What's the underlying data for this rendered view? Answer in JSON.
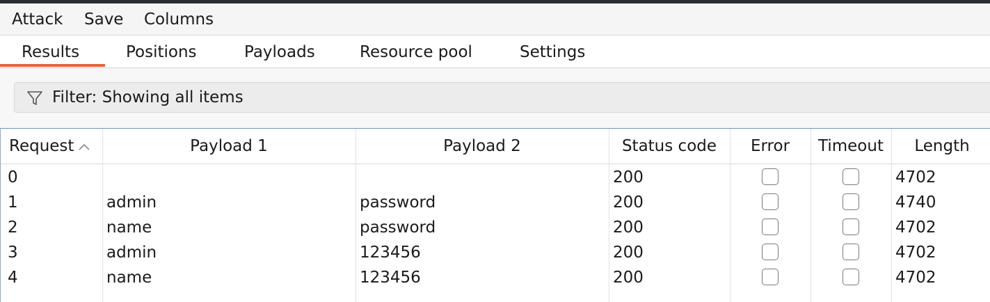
{
  "menu": {
    "items": [
      {
        "label": "Attack"
      },
      {
        "label": "Save"
      },
      {
        "label": "Columns"
      }
    ]
  },
  "tabs": [
    {
      "label": "Results",
      "active": true
    },
    {
      "label": "Positions",
      "active": false
    },
    {
      "label": "Payloads",
      "active": false
    },
    {
      "label": "Resource pool",
      "active": false
    },
    {
      "label": "Settings",
      "active": false
    }
  ],
  "filter": {
    "label": "Filter: Showing all items",
    "icon": "filter-icon"
  },
  "table": {
    "sort": {
      "column": "Request",
      "direction": "ascending",
      "icon": "chevron-up-icon"
    },
    "columns": [
      "Request",
      "Payload 1",
      "Payload 2",
      "Status code",
      "Error",
      "Timeout",
      "Length"
    ],
    "rows": [
      {
        "request": "0",
        "payload1": "",
        "payload2": "",
        "status": "200",
        "error": false,
        "timeout": false,
        "length": "4702"
      },
      {
        "request": "1",
        "payload1": "admin",
        "payload2": "password",
        "status": "200",
        "error": false,
        "timeout": false,
        "length": "4740"
      },
      {
        "request": "2",
        "payload1": "name",
        "payload2": "password",
        "status": "200",
        "error": false,
        "timeout": false,
        "length": "4702"
      },
      {
        "request": "3",
        "payload1": "admin",
        "payload2": "123456",
        "status": "200",
        "error": false,
        "timeout": false,
        "length": "4702"
      },
      {
        "request": "4",
        "payload1": "name",
        "payload2": "123456",
        "status": "200",
        "error": false,
        "timeout": false,
        "length": "4702"
      }
    ]
  },
  "colors": {
    "active_tab_underline": "#e8633a",
    "table_border_accent": "#6f95c8"
  }
}
